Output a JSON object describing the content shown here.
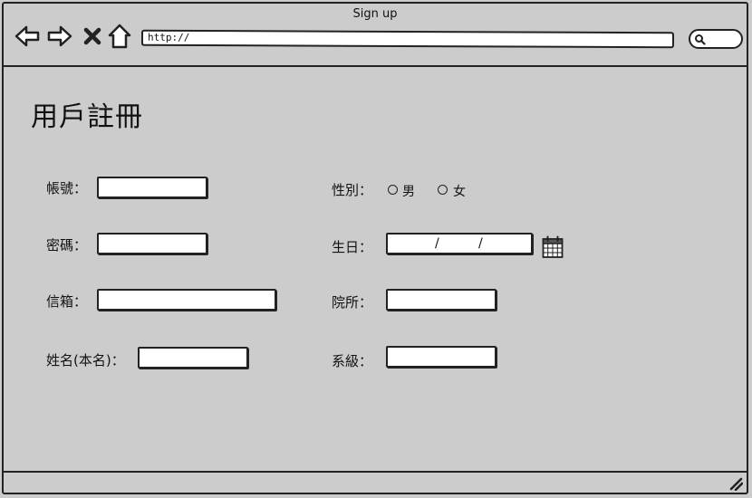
{
  "window": {
    "title": "Sign up",
    "url": "http://"
  },
  "nav": {
    "back_icon": "arrow-left-icon",
    "forward_icon": "arrow-right-icon",
    "close_icon": "close-icon",
    "home_icon": "home-icon",
    "search_icon": "search-icon"
  },
  "form": {
    "heading": "用戶註冊",
    "account_label": "帳號：",
    "password_label": "密碼：",
    "email_label": "信箱：",
    "name_label": "姓名(本名)：",
    "gender_label": "性別：",
    "gender_options": [
      "男",
      "女"
    ],
    "birthday_label": "生日：",
    "birthday_separator": "/",
    "institute_label": "院所：",
    "department_label": "系級："
  },
  "colors": {
    "background": "#cccccc",
    "border": "#222222",
    "field": "#ffffff"
  }
}
